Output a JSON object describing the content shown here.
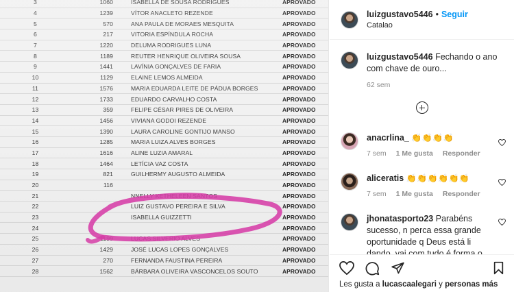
{
  "results": [
    {
      "n": "3",
      "code": "1060",
      "name": "Isabella de Sousa Rodrigues",
      "status": "APROVADO"
    },
    {
      "n": "4",
      "code": "1239",
      "name": "Vítor Anacleto Rezende",
      "status": "APROVADO"
    },
    {
      "n": "5",
      "code": "570",
      "name": "Ana Paula de Moraes Mesquita",
      "status": "APROVADO"
    },
    {
      "n": "6",
      "code": "217",
      "name": "Vitoria Espíndula Rocha",
      "status": "APROVADO"
    },
    {
      "n": "7",
      "code": "1220",
      "name": "Deluma Rodrigues Luna",
      "status": "APROVADO"
    },
    {
      "n": "8",
      "code": "1189",
      "name": "Reuter Henrique Oliveira Sousa",
      "status": "APROVADO"
    },
    {
      "n": "9",
      "code": "1441",
      "name": "Lavínia Gonçalves de Faria",
      "status": "APROVADO"
    },
    {
      "n": "10",
      "code": "1129",
      "name": "Elaine Lemos Almeida",
      "status": "APROVADO"
    },
    {
      "n": "11",
      "code": "1576",
      "name": "Maria Eduarda Leite de Pádua Borges",
      "status": "APROVADO"
    },
    {
      "n": "12",
      "code": "1733",
      "name": "Eduardo Carvalho Costa",
      "status": "APROVADO"
    },
    {
      "n": "13",
      "code": "359",
      "name": "Felipe César Pires de Oliveira",
      "status": "APROVADO"
    },
    {
      "n": "14",
      "code": "1456",
      "name": "Viviana Godoi Rezende",
      "status": "APROVADO"
    },
    {
      "n": "15",
      "code": "1390",
      "name": "Laura Caroline Gontijo Manso",
      "status": "APROVADO"
    },
    {
      "n": "16",
      "code": "1285",
      "name": "Maria Luiza Alves Borges",
      "status": "APROVADO"
    },
    {
      "n": "17",
      "code": "1616",
      "name": "Aline Luzia Amaral",
      "status": "APROVADO"
    },
    {
      "n": "18",
      "code": "1464",
      "name": "Letícia Vaz Costa",
      "status": "APROVADO"
    },
    {
      "n": "19",
      "code": "821",
      "name": "Guilhermy Augusto Almeida",
      "status": "APROVADO"
    },
    {
      "n": "20",
      "code": "116",
      "name": "",
      "status": "APROVADO"
    },
    {
      "n": "21",
      "code": "",
      "name": "Nnelly Ketheleen Santos",
      "status": "APROVADO"
    },
    {
      "n": "22",
      "code": "",
      "name": "Luiz Gustavo Pereira e Silva",
      "status": "APROVADO"
    },
    {
      "n": "23",
      "code": "",
      "name": "Isabella Guizzetti",
      "status": "APROVADO"
    },
    {
      "n": "24",
      "code": "",
      "name": "",
      "status": "APROVADO"
    },
    {
      "n": "25",
      "code": "1199",
      "name": "Lucas Silverio Alves",
      "status": "APROVADO"
    },
    {
      "n": "26",
      "code": "1429",
      "name": "José Lucas Lopes Gonçalves",
      "status": "APROVADO"
    },
    {
      "n": "27",
      "code": "270",
      "name": "Fernanda Faustina Pereira",
      "status": "APROVADO"
    },
    {
      "n": "28",
      "code": "1562",
      "name": "Bárbara Oliveira Vasconcelos Souto",
      "status": "APROVADO"
    }
  ],
  "header": {
    "username": "luizgustavo5446",
    "dot": "•",
    "follow_label": "Seguir",
    "location": "Catalao"
  },
  "caption": {
    "username": "luizgustavo5446",
    "text": "Fechando o ano com chave de ouro...",
    "time": "62 sem"
  },
  "comments": [
    {
      "username": "anacrlina_",
      "text": "👏👏👏👏",
      "time": "7 sem",
      "likes": "1 Me gusta",
      "reply": "Responder"
    },
    {
      "username": "aliceratis",
      "text": "👏👏👏👏👏👏",
      "time": "7 sem",
      "likes": "1 Me gusta",
      "reply": "Responder"
    },
    {
      "username": "jhonatasporto23",
      "text": "Parabéns sucesso, n perca essa grande oportunidade q Deus está li dando, vai com tudo é forma o",
      "time": "",
      "likes": "",
      "reply": ""
    }
  ],
  "likes_line": {
    "prefix": "Les gusta a",
    "user": "lucascaalegari",
    "middle": "y",
    "others": "personas más"
  },
  "colors": {
    "accent": "#0095f6",
    "marker": "#d63ea7",
    "text": "#262626",
    "muted": "#8e8e8e"
  }
}
